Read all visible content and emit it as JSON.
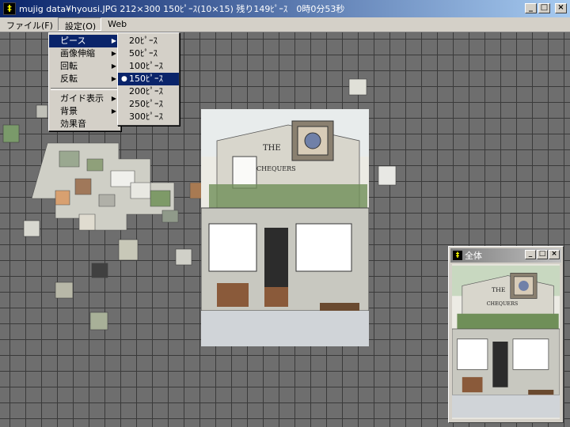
{
  "title_bar": {
    "icon": "puzzle-app-icon",
    "text": "mujig data¥hyousi.JPG 212×300 150ﾋﾟｰｽ(10×15) 残り149ﾋﾟｰｽ　0時0分53秒",
    "minimize": "_",
    "maximize": "□",
    "close": "×"
  },
  "menubar": {
    "file": "ファイル(F)",
    "settings": "設定(O)",
    "web": "Web"
  },
  "settings_menu": {
    "items": [
      {
        "label": "ピース"
      },
      {
        "label": "画像伸縮"
      },
      {
        "label": "回転"
      },
      {
        "label": "反転"
      },
      {
        "label": "ガイド表示"
      },
      {
        "label": "背景"
      },
      {
        "label": "効果音"
      }
    ]
  },
  "piece_submenu": {
    "items": [
      {
        "label": "20ﾋﾟｰｽ"
      },
      {
        "label": "50ﾋﾟｰｽ"
      },
      {
        "label": "100ﾋﾟｰｽ"
      },
      {
        "label": "150ﾋﾟｰｽ",
        "checked": true
      },
      {
        "label": "200ﾋﾟｰｽ"
      },
      {
        "label": "250ﾋﾟｰｽ"
      },
      {
        "label": "300ﾋﾟｰｽ"
      }
    ]
  },
  "puzzle_image": {
    "sign_text": "THE",
    "sign_text_2": "CHEQUERS"
  },
  "overview_window": {
    "title": "全体",
    "sign_text": "THE",
    "sign_text_2": "CHEQUERS"
  }
}
